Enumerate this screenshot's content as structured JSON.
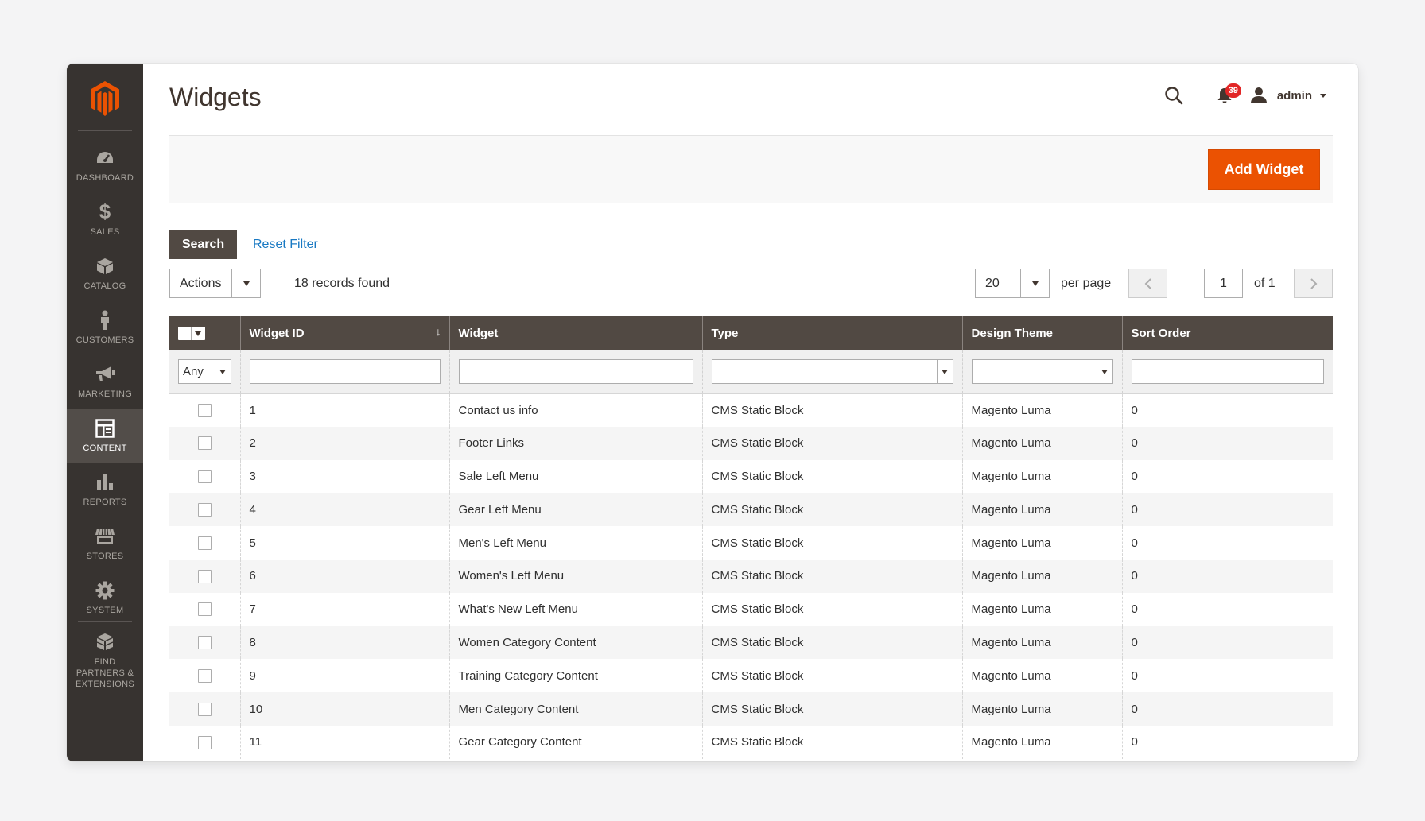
{
  "colors": {
    "brand": "#eb5202",
    "sidebar": "#373330",
    "header": "#514943",
    "link": "#1979c3",
    "badge": "#e22626"
  },
  "sidebar": {
    "logo_icon": "magento-logo-icon",
    "items": [
      {
        "label": "DASHBOARD",
        "icon": "dashboard-icon"
      },
      {
        "label": "SALES",
        "icon": "dollar-icon"
      },
      {
        "label": "CATALOG",
        "icon": "box-icon"
      },
      {
        "label": "CUSTOMERS",
        "icon": "person-icon"
      },
      {
        "label": "MARKETING",
        "icon": "megaphone-icon"
      },
      {
        "label": "CONTENT",
        "icon": "layout-icon",
        "active": true
      },
      {
        "label": "REPORTS",
        "icon": "bar-chart-icon"
      },
      {
        "label": "STORES",
        "icon": "store-icon"
      },
      {
        "label": "SYSTEM",
        "icon": "gear-icon"
      },
      {
        "label": "FIND PARTNERS & EXTENSIONS",
        "icon": "cubes-icon"
      }
    ]
  },
  "header": {
    "title": "Widgets",
    "notification_count": "39",
    "user_name": "admin"
  },
  "actions": {
    "add_label": "Add Widget"
  },
  "filters": {
    "search_label": "Search",
    "reset_label": "Reset Filter"
  },
  "toolbar": {
    "actions_label": "Actions",
    "records": "18 records found",
    "per_page_value": "20",
    "per_page_label": "per page",
    "page_value": "1",
    "page_of": "of 1"
  },
  "grid": {
    "columns": [
      "Widget ID",
      "Widget",
      "Type",
      "Design Theme",
      "Sort Order"
    ],
    "filter_any": "Any",
    "rows": [
      {
        "id": "1",
        "widget": "Contact us info",
        "type": "CMS Static Block",
        "theme": "Magento Luma",
        "sort": "0"
      },
      {
        "id": "2",
        "widget": "Footer Links",
        "type": "CMS Static Block",
        "theme": "Magento Luma",
        "sort": "0"
      },
      {
        "id": "3",
        "widget": "Sale Left Menu",
        "type": "CMS Static Block",
        "theme": "Magento Luma",
        "sort": "0"
      },
      {
        "id": "4",
        "widget": "Gear Left Menu",
        "type": "CMS Static Block",
        "theme": "Magento Luma",
        "sort": "0"
      },
      {
        "id": "5",
        "widget": "Men's Left Menu",
        "type": "CMS Static Block",
        "theme": "Magento Luma",
        "sort": "0"
      },
      {
        "id": "6",
        "widget": "Women's Left Menu",
        "type": "CMS Static Block",
        "theme": "Magento Luma",
        "sort": "0"
      },
      {
        "id": "7",
        "widget": "What's New Left Menu",
        "type": "CMS Static Block",
        "theme": "Magento Luma",
        "sort": "0"
      },
      {
        "id": "8",
        "widget": "Women Category Content",
        "type": "CMS Static Block",
        "theme": "Magento Luma",
        "sort": "0"
      },
      {
        "id": "9",
        "widget": "Training Category Content",
        "type": "CMS Static Block",
        "theme": "Magento Luma",
        "sort": "0"
      },
      {
        "id": "10",
        "widget": "Men Category Content",
        "type": "CMS Static Block",
        "theme": "Magento Luma",
        "sort": "0"
      },
      {
        "id": "11",
        "widget": "Gear Category Content",
        "type": "CMS Static Block",
        "theme": "Magento Luma",
        "sort": "0"
      }
    ]
  }
}
